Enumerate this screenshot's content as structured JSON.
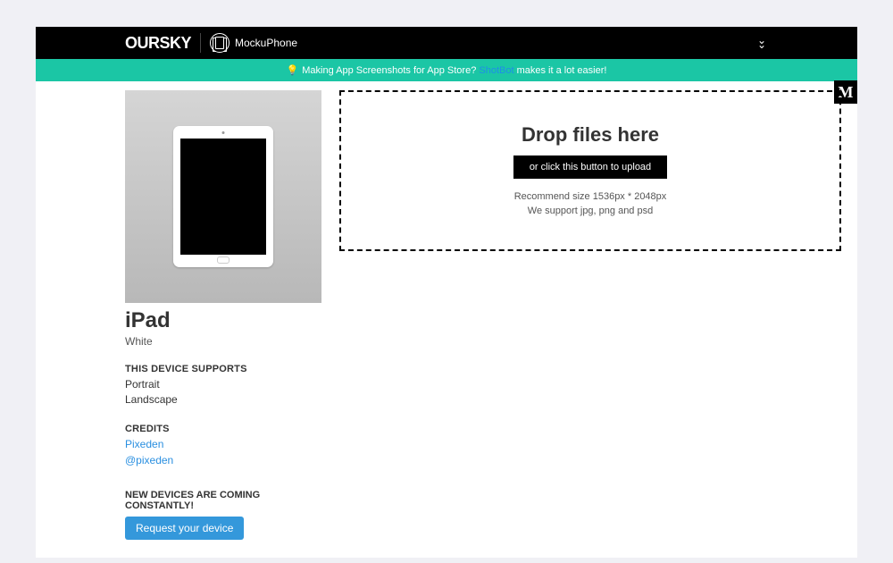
{
  "header": {
    "brand_primary": "OURSKY",
    "brand_secondary": "MockuPhone"
  },
  "banner": {
    "bulb": "💡",
    "prefix": "Making App Screenshots for App Store? ",
    "link_text": "ShotBot",
    "suffix": " makes it a lot easier!"
  },
  "device": {
    "name": "iPad",
    "color": "White",
    "supports_heading": "THIS DEVICE SUPPORTS",
    "supports": [
      "Portrait",
      "Landscape"
    ],
    "credits_heading": "CREDITS",
    "credits": [
      {
        "label": "Pixeden"
      },
      {
        "label": "@pixeden"
      }
    ],
    "new_devices_heading": "NEW DEVICES ARE COMING CONSTANTLY!",
    "request_button": "Request your device"
  },
  "dropzone": {
    "title": "Drop files here",
    "button": "or click this button to upload",
    "recommend": "Recommend size 1536px * 2048px",
    "support_line": "We support jpg, png and psd"
  },
  "badge": {
    "medium": "M"
  }
}
